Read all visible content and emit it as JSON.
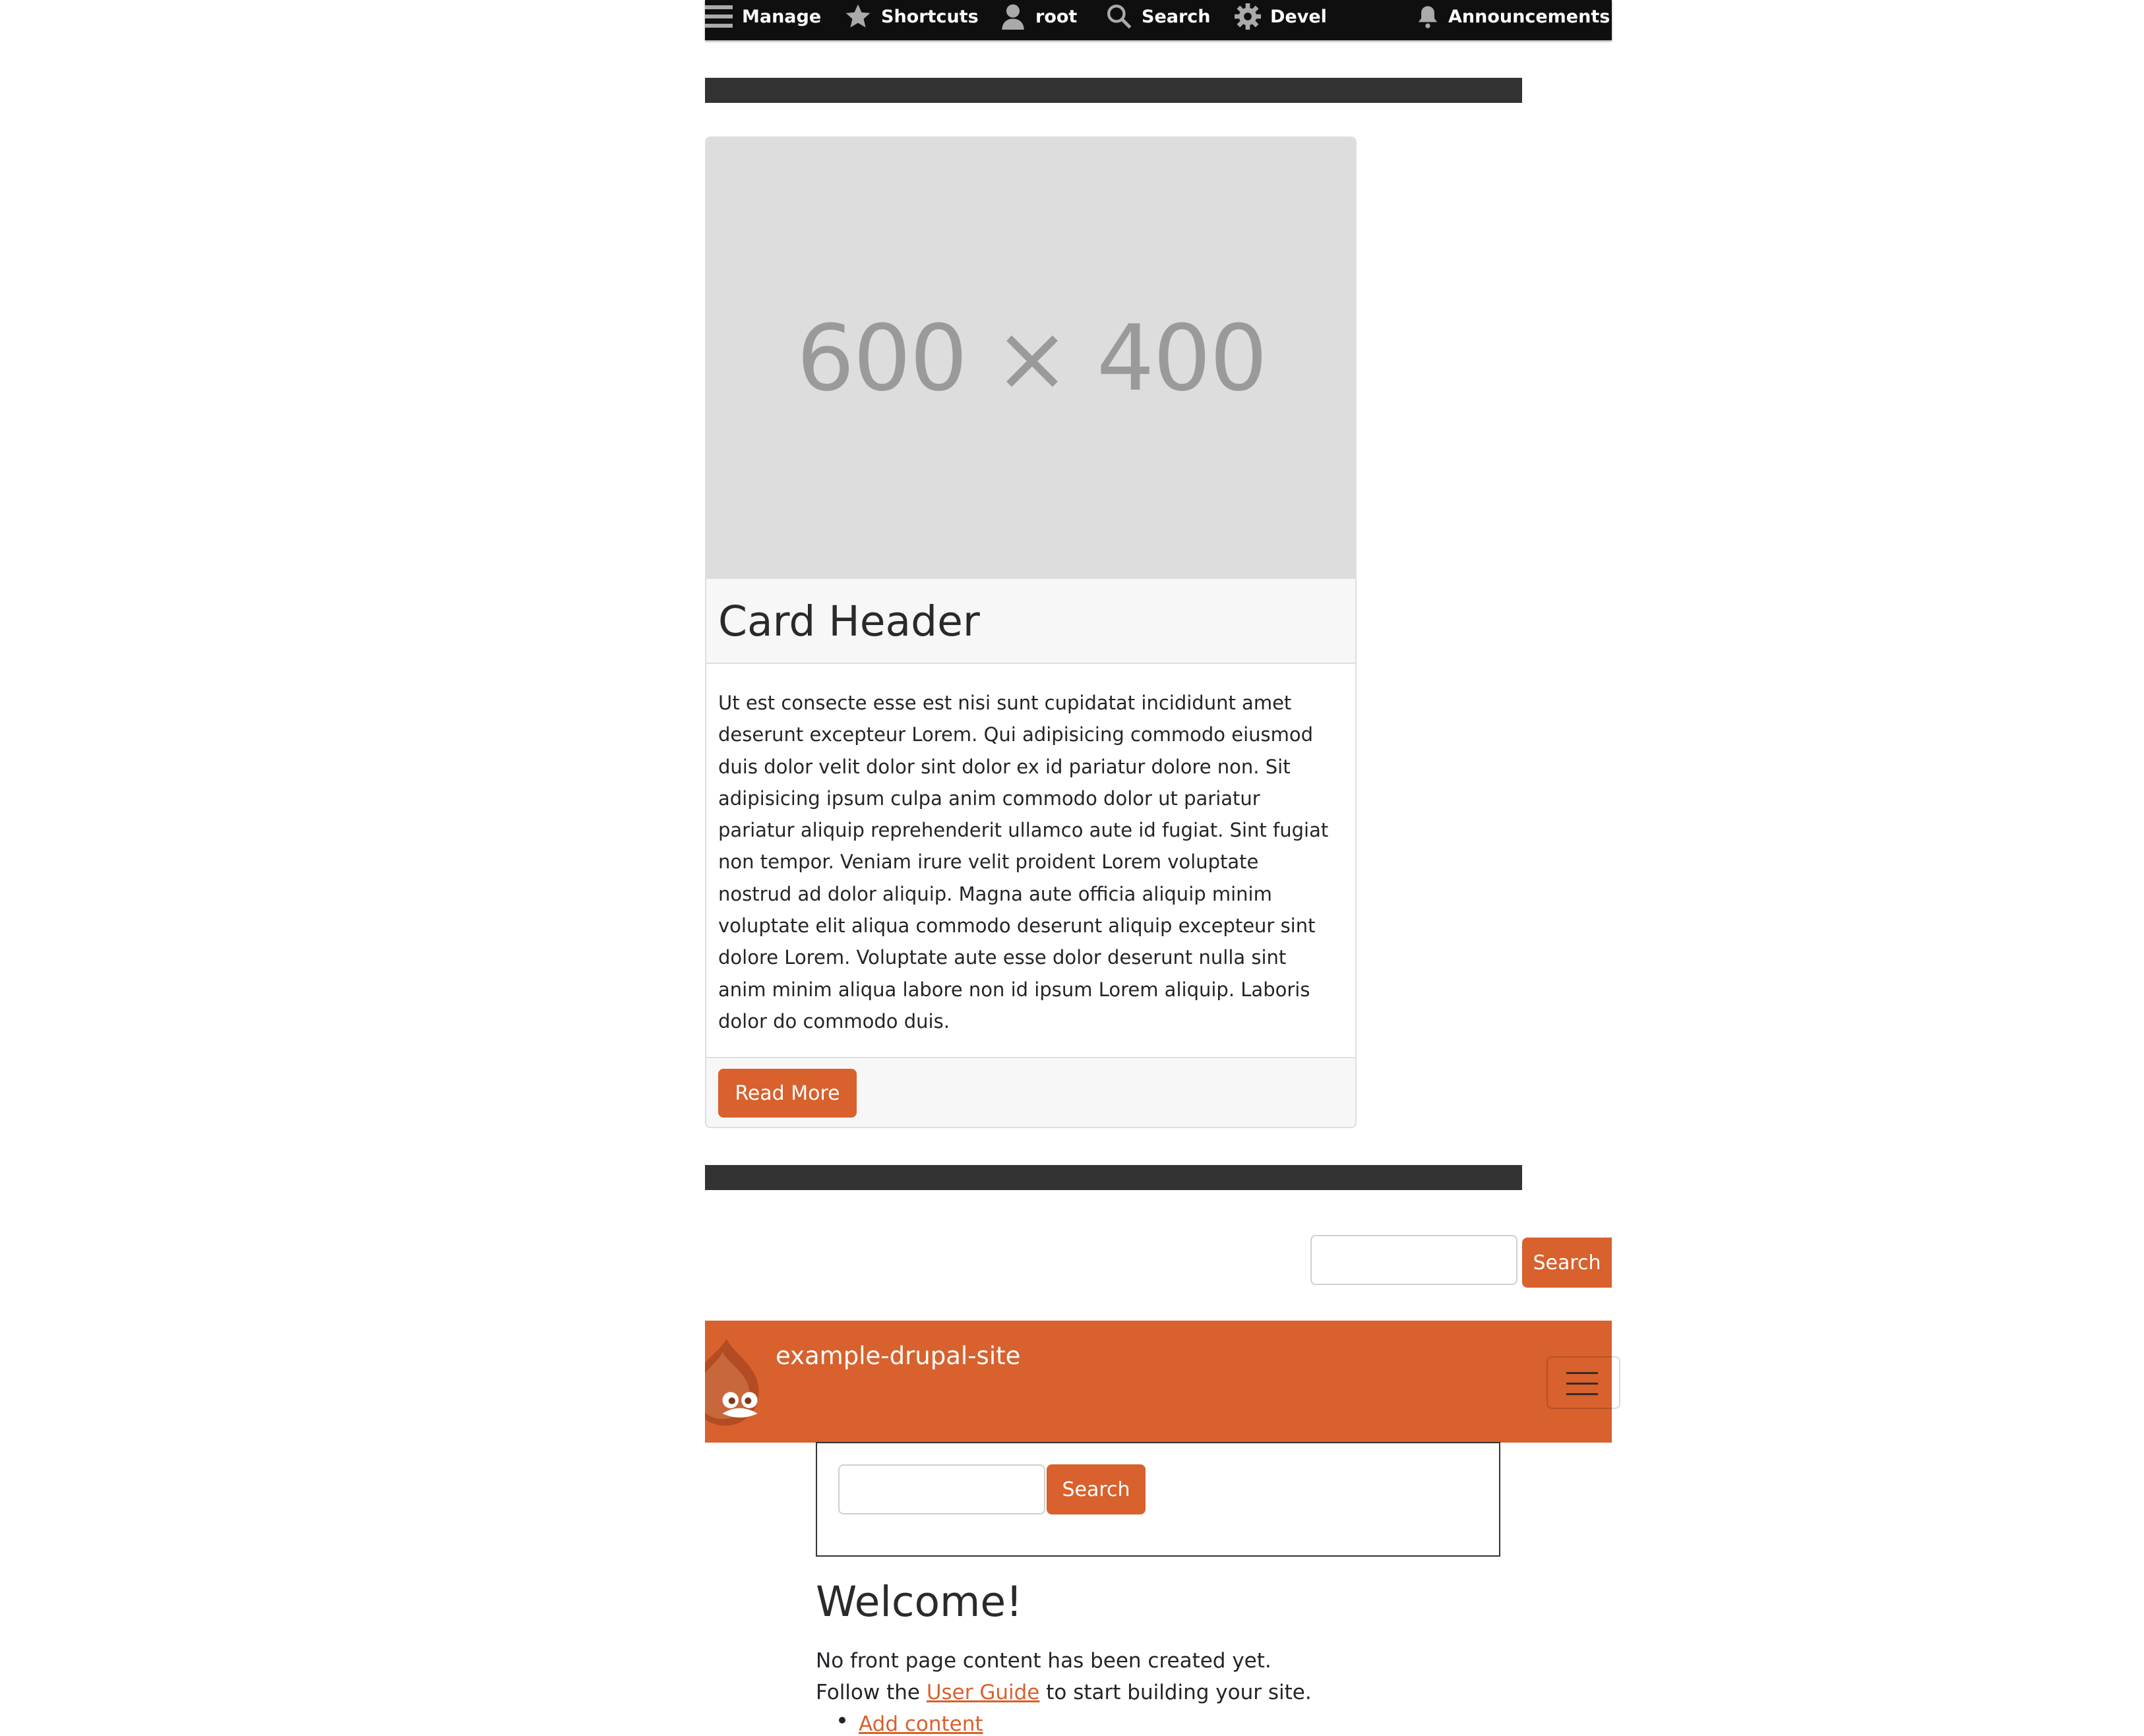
{
  "toolbar": {
    "manage": "Manage",
    "shortcuts": "Shortcuts",
    "user": "root",
    "search": "Search",
    "devel": "Devel",
    "announcements": "Announcements"
  },
  "card": {
    "image_text": "600 × 400",
    "header": "Card Header",
    "body_lines": [
      "Ut est consecte esse est nisi sunt cupidatat incididunt amet",
      "deserunt excepteur Lorem. Qui adipisicing commodo eiusmod",
      "duis dolor velit dolor sint dolor ex id pariatur dolore non. Sit",
      "adipisicing ipsum culpa anim commodo dolor ut pariatur",
      "pariatur aliquip reprehenderit ullamco aute id fugiat. Sint fugiat",
      "non tempor. Veniam irure velit proident Lorem voluptate",
      "nostrud ad dolor aliquip. Magna aute officia aliquip minim",
      "voluptate elit aliqua commodo deserunt aliquip excepteur sint",
      "dolore Lorem. Voluptate aute esse dolor deserunt nulla sint",
      "anim minim aliqua labore non id ipsum Lorem aliquip. Laboris",
      "dolor do commodo duis."
    ],
    "button": "Read More"
  },
  "top_search": {
    "button": "Search",
    "value": ""
  },
  "site": {
    "name": "example-drupal-site"
  },
  "header_search": {
    "button": "Search",
    "value": ""
  },
  "welcome": {
    "title": "Welcome!",
    "line1": "No front page content has been created yet.",
    "line2_before": "Follow the ",
    "line2_link": "User Guide",
    "line2_after": " to start building your site.",
    "list_item": "Add content"
  },
  "colors": {
    "accent": "#d8612d",
    "toolbar_bg": "#0f0f0f",
    "dark_bar": "#333333"
  }
}
